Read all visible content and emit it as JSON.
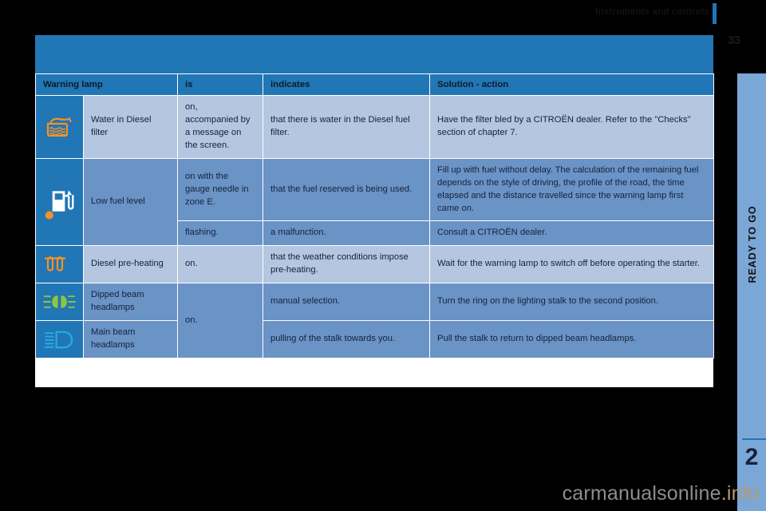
{
  "header": {
    "running_head": "Instruments and controls",
    "page_number": "33"
  },
  "side_tab": {
    "label": "READY TO GO",
    "chapter_number": "2"
  },
  "table": {
    "columns": [
      "Warning lamp",
      "is",
      "indicates",
      "Solution - action"
    ],
    "rows": [
      {
        "icon": "water-in-diesel-filter-icon",
        "name": "Water in Diesel filter",
        "is": "on,\naccompanied by\na message on\nthe screen.",
        "indicates": "that there is water in the Diesel fuel filter.",
        "solution": "Have the filter bled by a CITROËN dealer. Refer to the \"Checks\" section of chapter 7."
      },
      {
        "icon": "low-fuel-level-icon",
        "name": "Low fuel level",
        "is": "on with the gauge needle in zone E.",
        "indicates": "that the fuel reserved is being used.",
        "solution": "Fill up with fuel without delay. The calculation of the remaining fuel depends on the style of driving, the profile of the road, the time elapsed and the distance travelled since the warning lamp first came on."
      },
      {
        "icon": "low-fuel-level-icon",
        "name": "Low fuel level",
        "is": "flashing.",
        "indicates": "a malfunction.",
        "solution": "Consult a CITROËN dealer."
      },
      {
        "icon": "diesel-pre-heating-icon",
        "name": "Diesel pre-heating",
        "is": "on.",
        "indicates": "that the weather conditions impose pre-heating.",
        "solution": "Wait for the warning lamp to switch off before operating the starter."
      },
      {
        "icon": "dipped-beam-headlamps-icon",
        "name": "Dipped beam headlamps",
        "is": "on.",
        "indicates": "manual selection.",
        "solution": "Turn the ring on the lighting stalk to the second position."
      },
      {
        "icon": "main-beam-headlamps-icon",
        "name": "Main beam headlamps",
        "is": "on.",
        "indicates": "pulling of the stalk towards you.",
        "solution": "Pull the stalk to return to dipped beam headlamps."
      }
    ]
  },
  "watermark": {
    "text": "carmanualsonline",
    "tld": ".info"
  },
  "colors": {
    "brand_blue": "#2176b6",
    "row_light": "#b4c6e0",
    "row_dark": "#6a93c6",
    "side_tab": "#7ba7d7",
    "icon_orange": "#f39325",
    "icon_green": "#8dc63f",
    "icon_cyan": "#29abe2",
    "icon_white": "#ffffff"
  }
}
